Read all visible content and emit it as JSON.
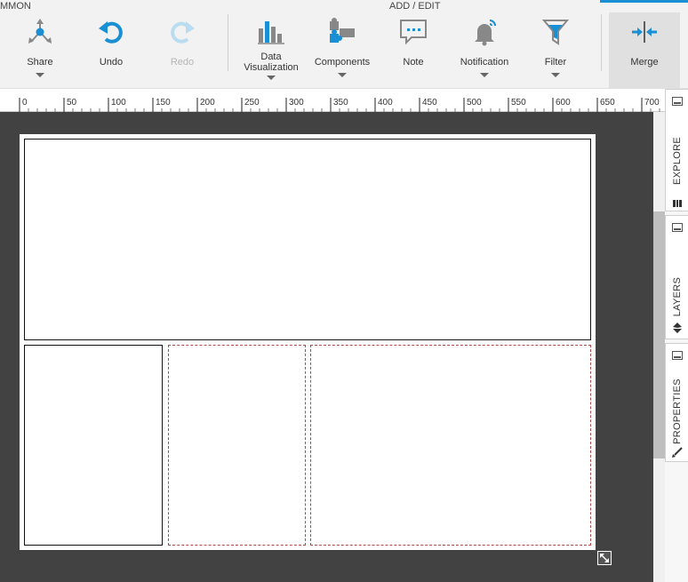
{
  "toolbar": {
    "group_common": "MMON",
    "group_add_edit": "ADD / EDIT",
    "tools": {
      "share": "Share",
      "undo": "Undo",
      "redo": "Redo",
      "data_viz_line1": "Data",
      "data_viz_line2": "Visualization",
      "components": "Components",
      "note": "Note",
      "notification": "Notification",
      "filter": "Filter",
      "merge": "Merge"
    },
    "accent_color": "#1a8fd3"
  },
  "ruler": {
    "ticks": [
      "0",
      "50",
      "100",
      "150",
      "200",
      "250",
      "300",
      "350",
      "400",
      "450",
      "500",
      "550",
      "600",
      "650",
      "700"
    ]
  },
  "side_tabs": {
    "explore": "EXPLORE",
    "layers": "LAYERS",
    "properties": "PROPERTIES"
  }
}
